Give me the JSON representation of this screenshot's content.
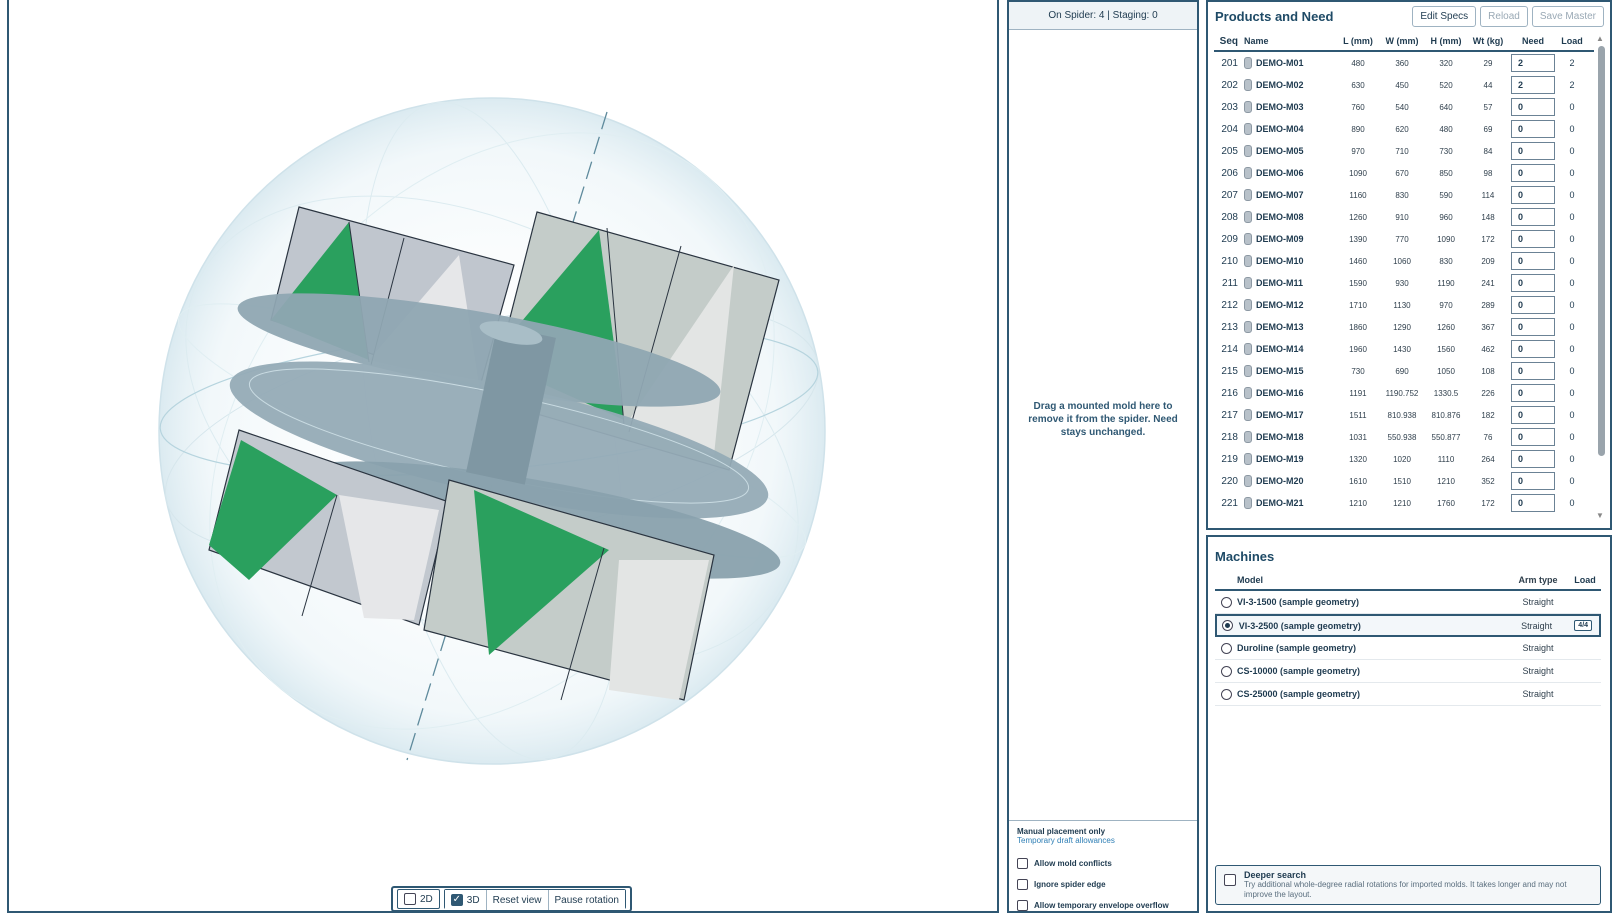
{
  "view_toolbar": {
    "toggle_2d": {
      "label": "2D",
      "checked": false
    },
    "toggle_3d": {
      "label": "3D",
      "checked": true
    },
    "reset_label": "Reset view",
    "pause_label": "Pause rotation"
  },
  "staging": {
    "status": "On Spider: 4 | Staging: 0",
    "drop_hint": "Drag a mounted mold here to remove it from the spider. Need stays unchanged.",
    "mode_title": "Manual placement only",
    "mode_sub": "Temporary draft allowances",
    "options": [
      {
        "label": "Allow mold conflicts",
        "checked": false
      },
      {
        "label": "Ignore spider edge",
        "checked": false
      },
      {
        "label": "Allow temporary envelope overflow",
        "checked": false
      }
    ]
  },
  "products": {
    "title": "Products and Need",
    "buttons": {
      "edit": "Edit Specs",
      "reload": "Reload",
      "save": "Save Master"
    },
    "columns": {
      "seq": "Seq",
      "name": "Name",
      "l": "L (mm)",
      "w": "W (mm)",
      "h": "H (mm)",
      "wt": "Wt (kg)",
      "need": "Need",
      "load": "Load"
    },
    "rows": [
      {
        "seq": "201",
        "name": "DEMO-M01",
        "l": "480",
        "w": "360",
        "h": "320",
        "wt": "29",
        "need": "2",
        "load": "2"
      },
      {
        "seq": "202",
        "name": "DEMO-M02",
        "l": "630",
        "w": "450",
        "h": "520",
        "wt": "44",
        "need": "2",
        "load": "2"
      },
      {
        "seq": "203",
        "name": "DEMO-M03",
        "l": "760",
        "w": "540",
        "h": "640",
        "wt": "57",
        "need": "0",
        "load": "0"
      },
      {
        "seq": "204",
        "name": "DEMO-M04",
        "l": "890",
        "w": "620",
        "h": "480",
        "wt": "69",
        "need": "0",
        "load": "0"
      },
      {
        "seq": "205",
        "name": "DEMO-M05",
        "l": "970",
        "w": "710",
        "h": "730",
        "wt": "84",
        "need": "0",
        "load": "0"
      },
      {
        "seq": "206",
        "name": "DEMO-M06",
        "l": "1090",
        "w": "670",
        "h": "850",
        "wt": "98",
        "need": "0",
        "load": "0"
      },
      {
        "seq": "207",
        "name": "DEMO-M07",
        "l": "1160",
        "w": "830",
        "h": "590",
        "wt": "114",
        "need": "0",
        "load": "0"
      },
      {
        "seq": "208",
        "name": "DEMO-M08",
        "l": "1260",
        "w": "910",
        "h": "960",
        "wt": "148",
        "need": "0",
        "load": "0"
      },
      {
        "seq": "209",
        "name": "DEMO-M09",
        "l": "1390",
        "w": "770",
        "h": "1090",
        "wt": "172",
        "need": "0",
        "load": "0"
      },
      {
        "seq": "210",
        "name": "DEMO-M10",
        "l": "1460",
        "w": "1060",
        "h": "830",
        "wt": "209",
        "need": "0",
        "load": "0"
      },
      {
        "seq": "211",
        "name": "DEMO-M11",
        "l": "1590",
        "w": "930",
        "h": "1190",
        "wt": "241",
        "need": "0",
        "load": "0"
      },
      {
        "seq": "212",
        "name": "DEMO-M12",
        "l": "1710",
        "w": "1130",
        "h": "970",
        "wt": "289",
        "need": "0",
        "load": "0"
      },
      {
        "seq": "213",
        "name": "DEMO-M13",
        "l": "1860",
        "w": "1290",
        "h": "1260",
        "wt": "367",
        "need": "0",
        "load": "0"
      },
      {
        "seq": "214",
        "name": "DEMO-M14",
        "l": "1960",
        "w": "1430",
        "h": "1560",
        "wt": "462",
        "need": "0",
        "load": "0"
      },
      {
        "seq": "215",
        "name": "DEMO-M15",
        "l": "730",
        "w": "690",
        "h": "1050",
        "wt": "108",
        "need": "0",
        "load": "0"
      },
      {
        "seq": "216",
        "name": "DEMO-M16",
        "l": "1191",
        "w": "1190.752",
        "h": "1330.5",
        "wt": "226",
        "need": "0",
        "load": "0"
      },
      {
        "seq": "217",
        "name": "DEMO-M17",
        "l": "1511",
        "w": "810.938",
        "h": "810.876",
        "wt": "182",
        "need": "0",
        "load": "0"
      },
      {
        "seq": "218",
        "name": "DEMO-M18",
        "l": "1031",
        "w": "550.938",
        "h": "550.877",
        "wt": "76",
        "need": "0",
        "load": "0"
      },
      {
        "seq": "219",
        "name": "DEMO-M19",
        "l": "1320",
        "w": "1020",
        "h": "1110",
        "wt": "264",
        "need": "0",
        "load": "0"
      },
      {
        "seq": "220",
        "name": "DEMO-M20",
        "l": "1610",
        "w": "1510",
        "h": "1210",
        "wt": "352",
        "need": "0",
        "load": "0"
      },
      {
        "seq": "221",
        "name": "DEMO-M21",
        "l": "1210",
        "w": "1210",
        "h": "1760",
        "wt": "172",
        "need": "0",
        "load": "0"
      }
    ]
  },
  "machines": {
    "title": "Machines",
    "columns": {
      "model": "Model",
      "arm": "Arm type",
      "load": "Load"
    },
    "rows": [
      {
        "model": "VI-3-1500 (sample geometry)",
        "arm": "Straight",
        "load": "",
        "selected": false
      },
      {
        "model": "VI-3-2500 (sample geometry)",
        "arm": "Straight",
        "load": "4/4",
        "selected": true
      },
      {
        "model": "Duroline (sample geometry)",
        "arm": "Straight",
        "load": "",
        "selected": false
      },
      {
        "model": "CS-10000 (sample geometry)",
        "arm": "Straight",
        "load": "",
        "selected": false
      },
      {
        "model": "CS-25000 (sample geometry)",
        "arm": "Straight",
        "load": "",
        "selected": false
      }
    ],
    "deeper": {
      "title": "Deeper search",
      "desc": "Try additional whole-degree radial rotations for imported molds. It takes longer and may not improve the layout.",
      "checked": false
    }
  },
  "colors": {
    "accent": "#2f5873",
    "green": "#2aa05e",
    "mold_grey": "#c5cad1",
    "arm": "#8fa6b2"
  }
}
